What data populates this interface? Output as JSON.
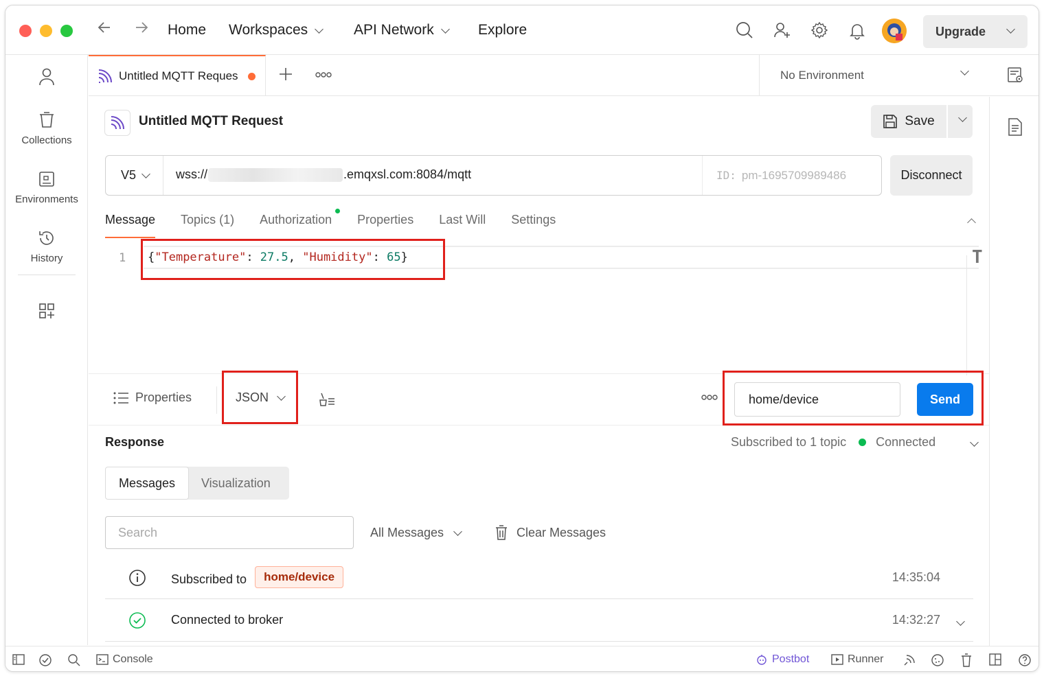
{
  "titlebar": {
    "nav": {
      "home": "Home",
      "workspaces": "Workspaces",
      "api_network": "API Network",
      "explore": "Explore"
    },
    "upgrade_label": "Upgrade",
    "icons": [
      "search-icon",
      "invite-user-icon",
      "settings-gear-icon",
      "notification-bell-icon",
      "avatar"
    ]
  },
  "sidebar": {
    "items": [
      {
        "label": "",
        "icon": "user-icon"
      },
      {
        "label": "Collections",
        "icon": "trash-bin-icon"
      },
      {
        "label": "Environments",
        "icon": "environment-icon"
      },
      {
        "label": "History",
        "icon": "history-icon"
      },
      {
        "label": "",
        "icon": "add-grid-icon"
      }
    ]
  },
  "tabs": {
    "active_tab_label": "Untitled MQTT Reques",
    "environment": "No Environment"
  },
  "request": {
    "title": "Untitled MQTT Request",
    "save_label": "Save",
    "version": "V5",
    "url_prefix": "wss://",
    "url_suffix": ".emqxsl.com:8084/mqtt",
    "client_id_key": "ID:",
    "client_id_value": "pm-1695709989486",
    "disconnect_label": "Disconnect"
  },
  "subtabs": {
    "message": "Message",
    "topics": "Topics (1)",
    "authorization": "Authorization",
    "properties": "Properties",
    "last_will": "Last Will",
    "settings": "Settings"
  },
  "editor": {
    "line_number": "1",
    "open_brace": "{",
    "key1": "\"Temperature\"",
    "sep1": ": ",
    "val1": "27.5",
    "comma": ", ",
    "key2": "\"Humidity\"",
    "sep2": ": ",
    "val2": "65",
    "close_brace": "}"
  },
  "editor_toolbar": {
    "properties_label": "Properties",
    "format_label": "JSON",
    "topic_value": "home/device",
    "send_label": "Send"
  },
  "response": {
    "title": "Response",
    "subscription_status": "Subscribed to 1 topic",
    "connection_status": "Connected",
    "segments": {
      "messages": "Messages",
      "visualization": "Visualization"
    },
    "search_placeholder": "Search",
    "filter_label": "All Messages",
    "clear_label": "Clear Messages",
    "rows": [
      {
        "text": "Subscribed to",
        "topic": "home/device",
        "time": "14:35:04",
        "icon": "info-icon"
      },
      {
        "text": "Connected to broker",
        "time": "14:32:27",
        "icon": "check-circle-icon"
      }
    ]
  },
  "statusbar": {
    "console": "Console",
    "postbot": "Postbot",
    "runner": "Runner"
  },
  "colors": {
    "accent": "#ff6c37",
    "send_blue": "#097bed",
    "connected_green": "#0cbb52",
    "highlight_red": "#e0201b"
  }
}
